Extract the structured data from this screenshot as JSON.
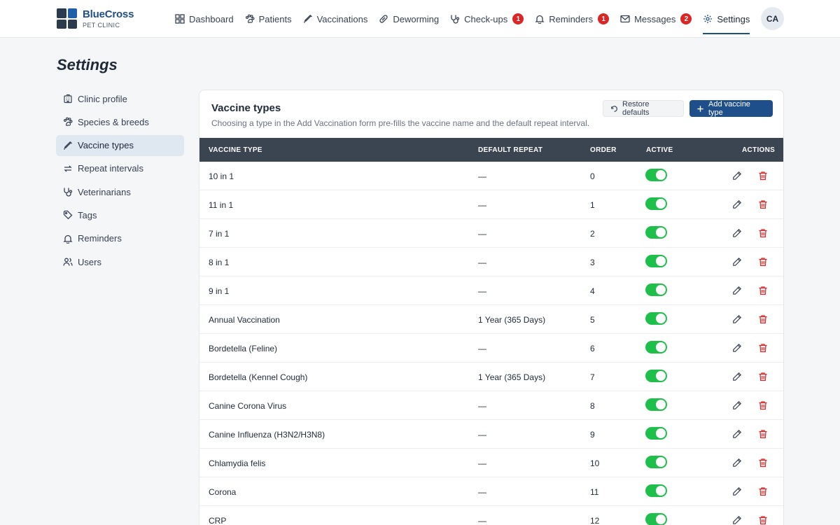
{
  "brand": {
    "name": "BlueCross",
    "sub": "PET CLINIC"
  },
  "nav": [
    {
      "label": "Dashboard",
      "icon": "grid-icon",
      "badge": ""
    },
    {
      "label": "Patients",
      "icon": "paw-icon",
      "badge": ""
    },
    {
      "label": "Vaccinations",
      "icon": "syringe-icon",
      "badge": ""
    },
    {
      "label": "Deworming",
      "icon": "pill-icon",
      "badge": ""
    },
    {
      "label": "Check-ups",
      "icon": "stethoscope-icon",
      "badge": "1"
    },
    {
      "label": "Reminders",
      "icon": "bell-icon",
      "badge": "1"
    },
    {
      "label": "Messages",
      "icon": "mail-icon",
      "badge": "2"
    },
    {
      "label": "Settings",
      "icon": "gear-icon",
      "badge": ""
    }
  ],
  "user": {
    "initials": "CA"
  },
  "page": {
    "title": "Settings"
  },
  "sidebar": [
    {
      "label": "Clinic profile",
      "icon": "building-icon"
    },
    {
      "label": "Species & breeds",
      "icon": "paw-icon"
    },
    {
      "label": "Vaccine types",
      "icon": "syringe-icon"
    },
    {
      "label": "Repeat intervals",
      "icon": "repeat-icon"
    },
    {
      "label": "Veterinarians",
      "icon": "stethoscope-icon"
    },
    {
      "label": "Tags",
      "icon": "tag-icon"
    },
    {
      "label": "Reminders",
      "icon": "bell-icon"
    },
    {
      "label": "Users",
      "icon": "users-icon"
    }
  ],
  "card": {
    "title": "Vaccine types",
    "subtitle": "Choosing a type in the Add Vaccination form pre-fills the vaccine name and the default repeat interval.",
    "restore_label": "Restore defaults",
    "add_label": "Add vaccine type"
  },
  "table": {
    "headers": {
      "type": "VACCINE TYPE",
      "repeat": "DEFAULT REPEAT",
      "order": "ORDER",
      "active": "ACTIVE",
      "actions": "ACTIONS"
    },
    "rows": [
      {
        "type": "10 in 1",
        "repeat": "—",
        "order": "0",
        "active": true
      },
      {
        "type": "11 in 1",
        "repeat": "—",
        "order": "1",
        "active": true
      },
      {
        "type": "7 in 1",
        "repeat": "—",
        "order": "2",
        "active": true
      },
      {
        "type": "8 in 1",
        "repeat": "—",
        "order": "3",
        "active": true
      },
      {
        "type": "9 in 1",
        "repeat": "—",
        "order": "4",
        "active": true
      },
      {
        "type": "Annual Vaccination",
        "repeat": "1 Year (365 Days)",
        "order": "5",
        "active": true
      },
      {
        "type": "Bordetella (Feline)",
        "repeat": "—",
        "order": "6",
        "active": true
      },
      {
        "type": "Bordetella (Kennel Cough)",
        "repeat": "1 Year (365 Days)",
        "order": "7",
        "active": true
      },
      {
        "type": "Canine Corona Virus",
        "repeat": "—",
        "order": "8",
        "active": true
      },
      {
        "type": "Canine Influenza (H3N2/H3N8)",
        "repeat": "—",
        "order": "9",
        "active": true
      },
      {
        "type": "Chlamydia felis",
        "repeat": "—",
        "order": "10",
        "active": true
      },
      {
        "type": "Corona",
        "repeat": "—",
        "order": "11",
        "active": true
      },
      {
        "type": "CRP",
        "repeat": "—",
        "order": "12",
        "active": true
      }
    ]
  },
  "colors": {
    "brand": "#1e4f8a",
    "badge": "#dc2626",
    "toggle_on": "#1fbf4c",
    "delete": "#dc2626",
    "table_header": "#3b4451"
  }
}
